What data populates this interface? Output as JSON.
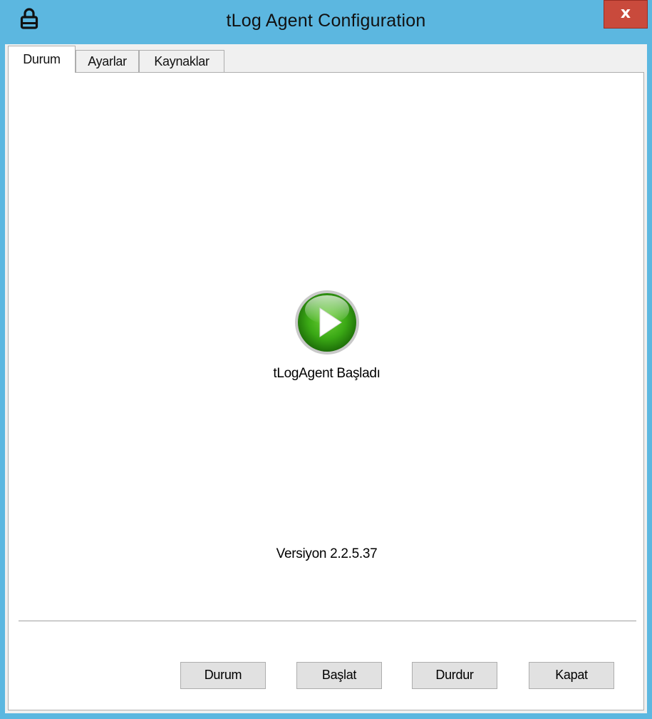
{
  "window": {
    "title": "tLog Agent Configuration",
    "close_label": "x",
    "accent_color": "#5cb7e0",
    "close_color": "#c94a3c"
  },
  "tabs": [
    {
      "label": "Durum",
      "active": true
    },
    {
      "label": "Ayarlar",
      "active": false
    },
    {
      "label": "Kaynaklar",
      "active": false
    }
  ],
  "status": {
    "icon": "play-icon",
    "icon_color": "#3aa815",
    "text": "tLogAgent Başladı"
  },
  "version": "Versiyon 2.2.5.37",
  "buttons": [
    {
      "label": "Durum"
    },
    {
      "label": "Başlat"
    },
    {
      "label": "Durdur"
    },
    {
      "label": "Kapat"
    }
  ]
}
